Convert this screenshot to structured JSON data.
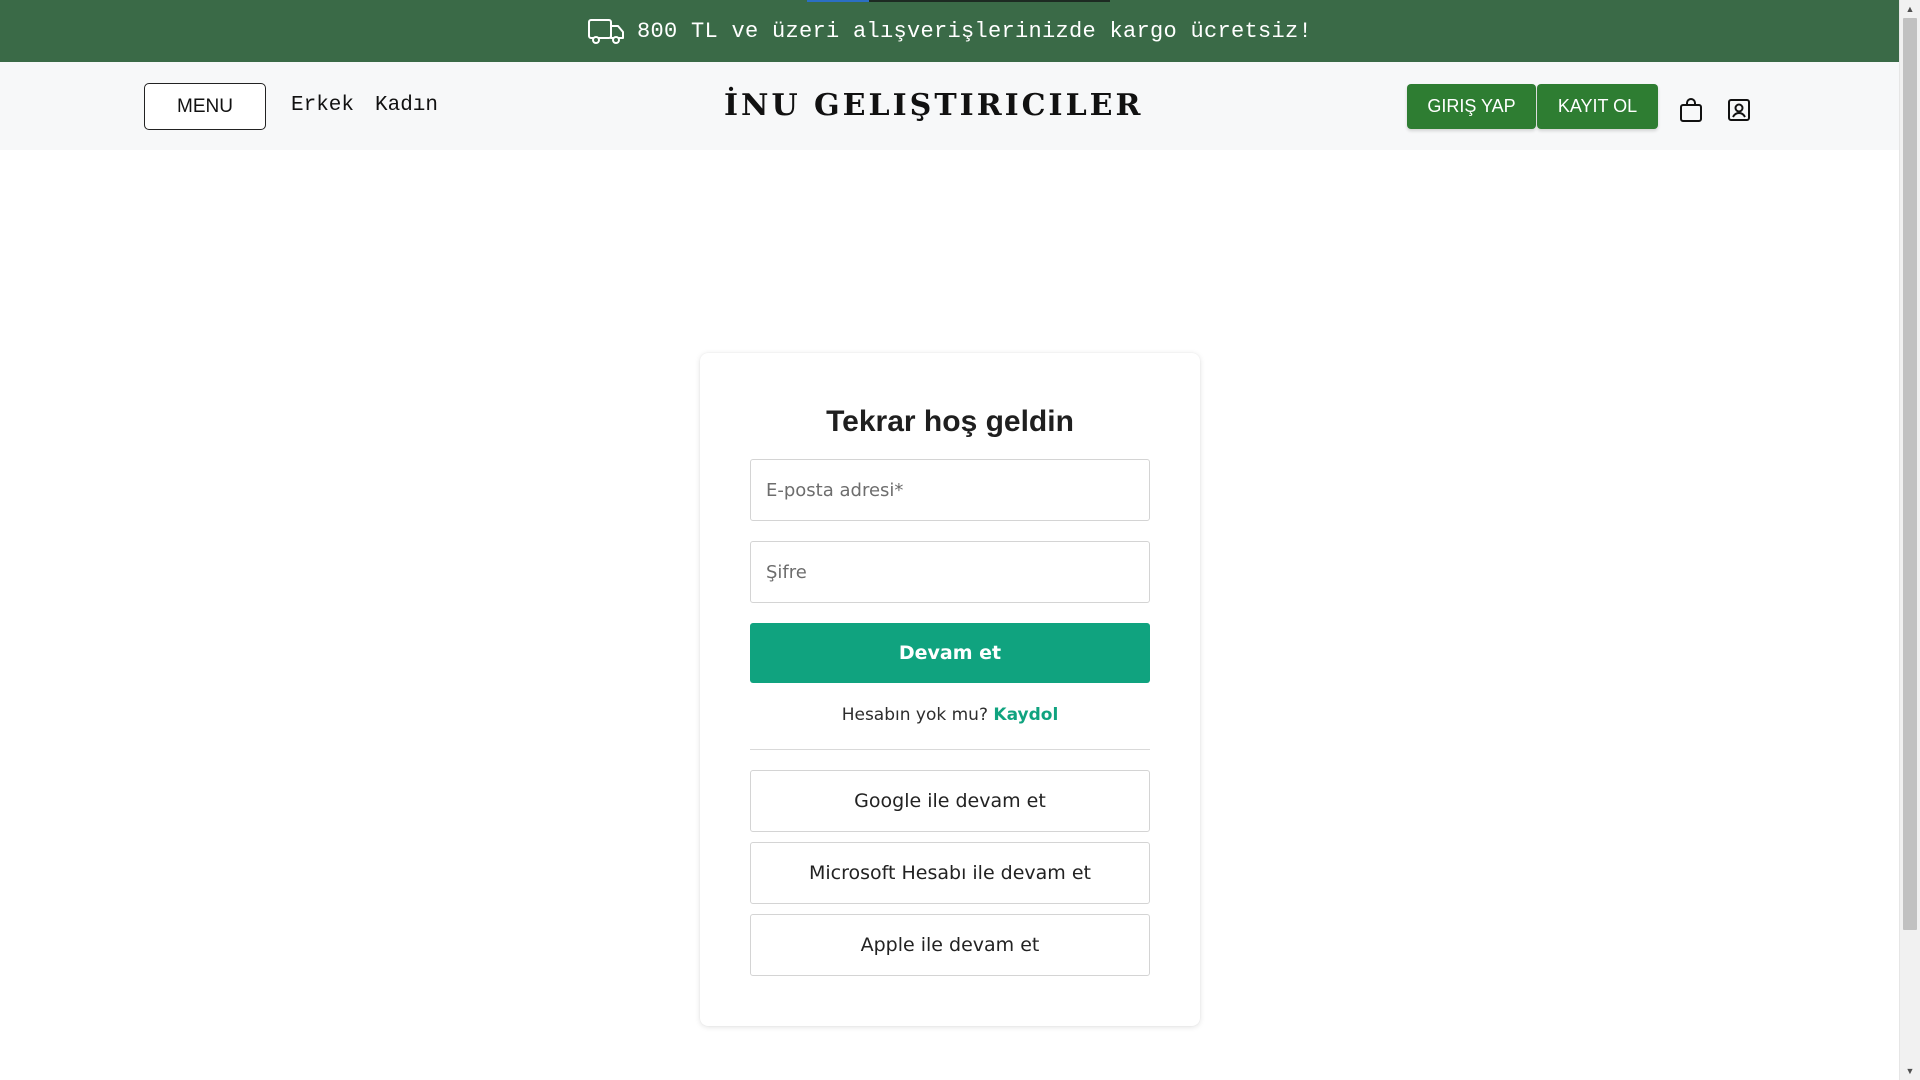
{
  "announcement": {
    "icon": "truck-icon",
    "text": "800 TL ve üzeri alışverişlerinizde kargo ücretsiz!"
  },
  "header": {
    "menu_label": "MENU",
    "nav": [
      "Erkek",
      "Kadın"
    ],
    "brand": "İNU GELIŞTIRICILER",
    "login_label": "GIRIŞ YAP",
    "register_label": "KAYIT OL",
    "cart_icon": "shopping-bag-icon",
    "profile_icon": "profile-icon"
  },
  "login": {
    "title": "Tekrar hoş geldin",
    "email_placeholder": "E-posta adresi*",
    "password_placeholder": "Şifre",
    "continue_label": "Devam et",
    "no_account_text": "Hesabın yok mu?",
    "signup_link": "Kaydol",
    "social": [
      "Google ile devam et",
      "Microsoft Hesabı ile devam et",
      "Apple ile devam et"
    ]
  },
  "colors": {
    "announcement_bg": "#3a6a47",
    "header_bg": "#f7f8f9",
    "header_button": "#2e7d32",
    "primary": "#10a37f"
  }
}
